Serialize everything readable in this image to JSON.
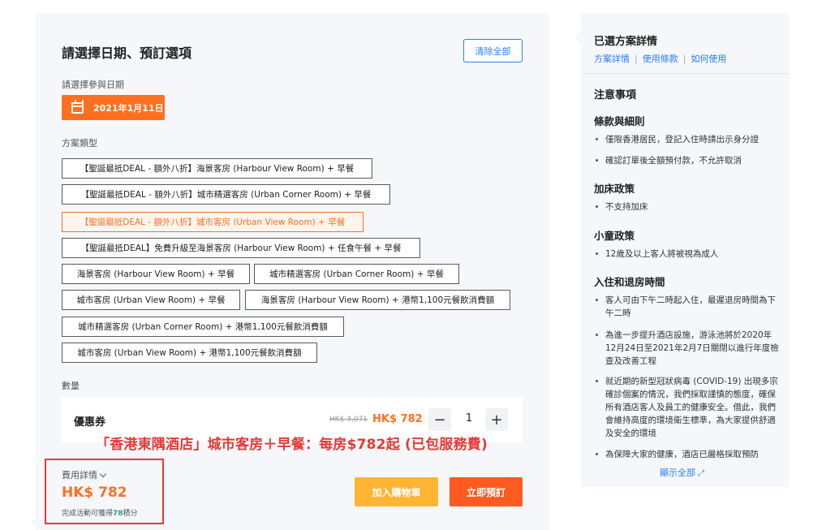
{
  "booking": {
    "title": "請選擇日期、預訂選項",
    "clear_all": "清除全部",
    "date_label": "請選擇參與日期",
    "selected_date": "2021年1月11日",
    "package_label": "方案類型",
    "packages": [
      "【聖誕最抵DEAL - 額外八折】海景客房 (Harbour View Room) + 早餐",
      "【聖誕最抵DEAL - 額外八折】城市精選客房 (Urban Corner Room) + 早餐",
      "【聖誕最抵DEAL - 額外八折】城市客房 (Urban View Room) + 早餐",
      "【聖誕最抵DEAL】免費升級至海景客房 (Harbour View Room) + 任食午餐 + 早餐",
      "海景客房 (Harbour View Room) + 早餐",
      "城市精選客房 (Urban Corner Room) + 早餐",
      "城市客房 (Urban View Room) + 早餐",
      "海景客房 (Harbour View Room) + 港幣1,100元餐飲消費額",
      "城市精選客房 (Urban Corner Room) + 港幣1,100元餐飲消費額",
      "城市客房 (Urban View Room) + 港幣1,100元餐飲消費額"
    ],
    "quantity_label": "數量",
    "item_name": "優惠券",
    "old_price": "HK$ 3,071",
    "new_price": "HK$ 782",
    "minus": "−",
    "quantity": "1",
    "plus": "+",
    "caption": "「香港東隅酒店」城市客房＋早餐：每房$782起 (已包服務費)",
    "fee_label": "費用詳情",
    "total": "HK$ 782",
    "points_prefix": "完成活動可獲得",
    "points_value": "78",
    "points_suffix": "積分",
    "add_to_cart": "加入購物車",
    "book_now": "立即預訂"
  },
  "details": {
    "title": "已選方案詳情",
    "links": [
      "方案詳情",
      "使用條款",
      "如何使用"
    ],
    "notes_title": "注意事項",
    "terms_title": "條款與細則",
    "terms": [
      "僅限香港居民，登記入住時請出示身分證",
      "確認訂單後全額預付款，不允許取消"
    ],
    "extra_bed_title": "加床政策",
    "extra_bed": [
      "不支持加床"
    ],
    "child_title": "小童政策",
    "child": [
      "12歲及以上客人將被視為成人"
    ],
    "checkin_title": "入住和退房時間",
    "checkin": [
      "客人可由下午二時起入住，最遲退房時間為下午二時",
      "為進一步提升酒店設施，游泳池將於2020年12月24日至2021年2月7日關閉以進行年度檢查及改善工程",
      "就近期的新型冠狀病毒 (COVID-19) 出現多宗確診個案的情況，我們採取謹慎的態度，確保所有酒店客人及員工的健康安全。借此，我們會維持高度的環境衛生標準，為大家提供舒適及安全的環境",
      "為保障大家的健康，酒店已嚴格採取預防"
    ],
    "show_all": "顯示全部"
  }
}
